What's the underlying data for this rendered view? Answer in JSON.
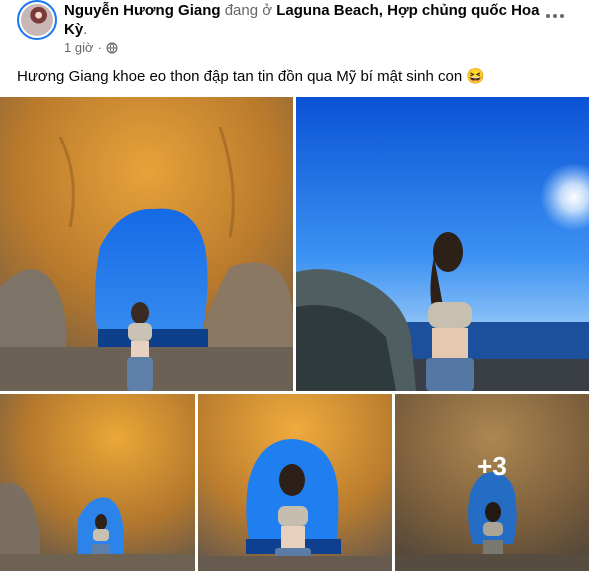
{
  "post": {
    "author": "Nguyễn Hương Giang",
    "location_prefix": " đang ở ",
    "location": "Laguna Beach, Hợp chủng quốc Hoa Kỳ",
    "location_suffix": ".",
    "timestamp": "1 giờ",
    "separator": "·",
    "privacy_icon": "globe-icon",
    "more_icon": "more-options-icon",
    "caption": "Hương Giang khoe eo thon đập tan tin đồn qua Mỹ bí mật sinh con 😆"
  },
  "gallery": {
    "photo_count": 5,
    "more_count_label": "+3"
  },
  "colors": {
    "link_blue": "#1877f2",
    "muted_text": "#65676b",
    "sky_blue": "#1e6fe0",
    "rock_gold": "#d48a2a"
  }
}
